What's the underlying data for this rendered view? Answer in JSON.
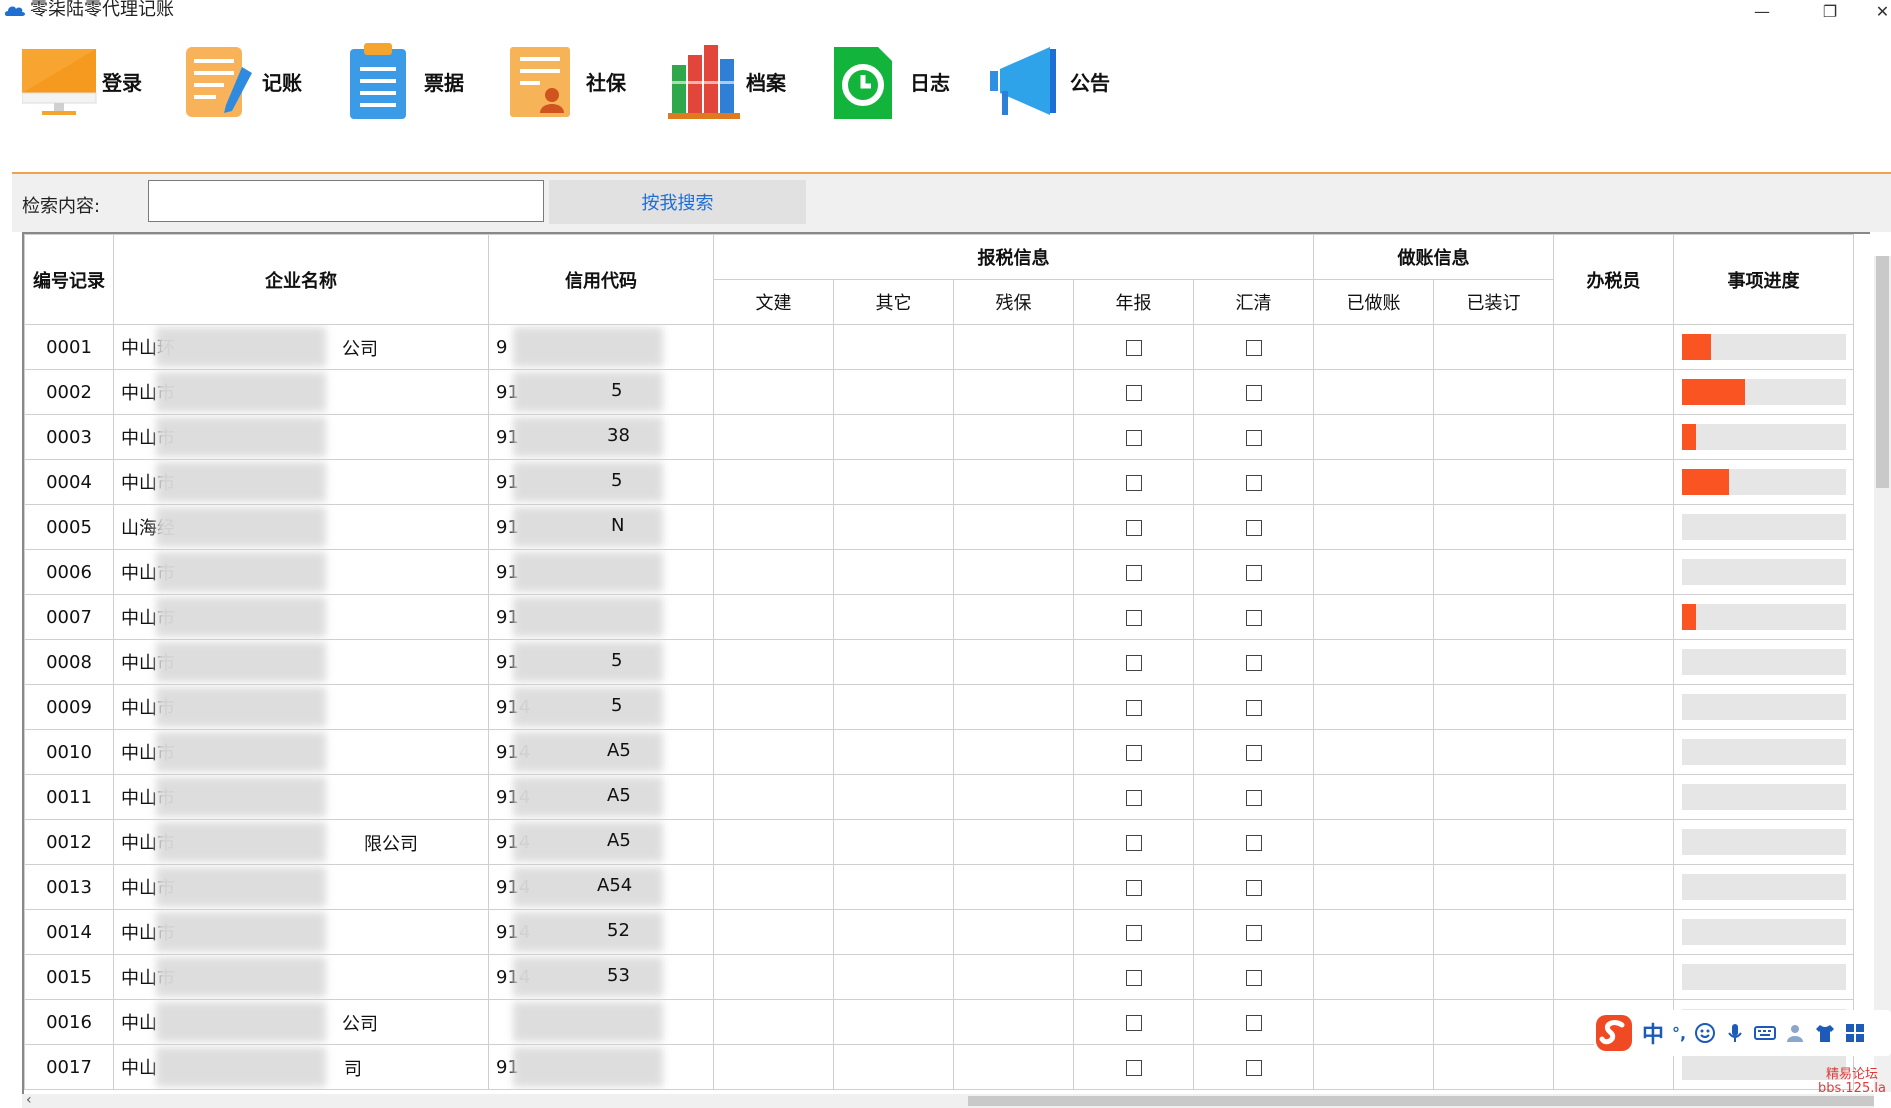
{
  "window": {
    "title": "零柒陆零代理记账",
    "minimize": "—",
    "restore": "❐",
    "close": "✕"
  },
  "toolbar": {
    "items": [
      {
        "label": "登录",
        "icon": "monitor-icon"
      },
      {
        "label": "记账",
        "icon": "notepad-pen-icon"
      },
      {
        "label": "票据",
        "icon": "clipboard-icon"
      },
      {
        "label": "社保",
        "icon": "person-document-icon"
      },
      {
        "label": "档案",
        "icon": "books-icon"
      },
      {
        "label": "日志",
        "icon": "clock-document-icon"
      },
      {
        "label": "公告",
        "icon": "megaphone-icon"
      }
    ]
  },
  "search": {
    "label": "检索内容:",
    "value": "",
    "placeholder": "",
    "button": "按我搜索"
  },
  "table": {
    "headers": {
      "id": "编号记录",
      "company": "企业名称",
      "code": "信用代码",
      "tax_group": "报税信息",
      "tax_cols": [
        "文建",
        "其它",
        "残保",
        "年报",
        "汇清"
      ],
      "acct_group": "做账信息",
      "acct_cols": [
        "已做账",
        "已装订"
      ],
      "agent": "办税员",
      "progress": "事项进度"
    },
    "rows": [
      {
        "id": "0001",
        "name_start": "中山环",
        "name_end": "公司",
        "code_start": "9",
        "code_end": "",
        "progress": 0.18
      },
      {
        "id": "0002",
        "name_start": "中山市",
        "name_end": "",
        "code_start": "91",
        "code_end": "5",
        "progress": 0.39
      },
      {
        "id": "0003",
        "name_start": "中山市",
        "name_end": "",
        "code_start": "91",
        "code_end": "38",
        "progress": 0.09
      },
      {
        "id": "0004",
        "name_start": "中山市",
        "name_end": "",
        "code_start": "91",
        "code_end": "5",
        "progress": 0.29
      },
      {
        "id": "0005",
        "name_start": "山海经",
        "name_end": "",
        "code_start": "91",
        "code_end": "N",
        "progress": 0
      },
      {
        "id": "0006",
        "name_start": "中山市",
        "name_end": "",
        "code_start": "91",
        "code_end": "",
        "progress": 0
      },
      {
        "id": "0007",
        "name_start": "中山市",
        "name_end": "",
        "code_start": "91",
        "code_end": "",
        "progress": 0.09
      },
      {
        "id": "0008",
        "name_start": "中山市",
        "name_end": "",
        "code_start": "91",
        "code_end": "5",
        "progress": 0
      },
      {
        "id": "0009",
        "name_start": "中山市",
        "name_end": "",
        "code_start": "914",
        "code_end": "5",
        "progress": 0
      },
      {
        "id": "0010",
        "name_start": "中山市",
        "name_end": "",
        "code_start": "914",
        "code_end": "A5",
        "progress": 0
      },
      {
        "id": "0011",
        "name_start": "中山市",
        "name_end": "",
        "code_start": "914",
        "code_end": "A5",
        "progress": 0
      },
      {
        "id": "0012",
        "name_start": "中山市",
        "name_end": "限公司",
        "code_start": "914",
        "code_end": "A5",
        "progress": 0
      },
      {
        "id": "0013",
        "name_start": "中山市",
        "name_end": "",
        "code_start": "914",
        "code_end": "A54",
        "progress": 0
      },
      {
        "id": "0014",
        "name_start": "中山市",
        "name_end": "",
        "code_start": "914",
        "code_end": "52",
        "progress": 0
      },
      {
        "id": "0015",
        "name_start": "中山市",
        "name_end": "",
        "code_start": "914",
        "code_end": "53",
        "progress": 0
      },
      {
        "id": "0016",
        "name_start": "中山",
        "name_end": "公司",
        "code_start": "",
        "code_end": "",
        "progress": 0
      },
      {
        "id": "0017",
        "name_start": "中山",
        "name_end": "司",
        "code_start": "91",
        "code_end": "",
        "progress": 0
      }
    ]
  },
  "ime": {
    "mode": "中",
    "punct": "°,"
  },
  "watermark": {
    "line1": "精易论坛",
    "line2": "bbs.125.la"
  },
  "colors": {
    "accent_orange": "#f3a24a",
    "progress": "#fa5423",
    "search_button_text": "#1d6fd6"
  }
}
